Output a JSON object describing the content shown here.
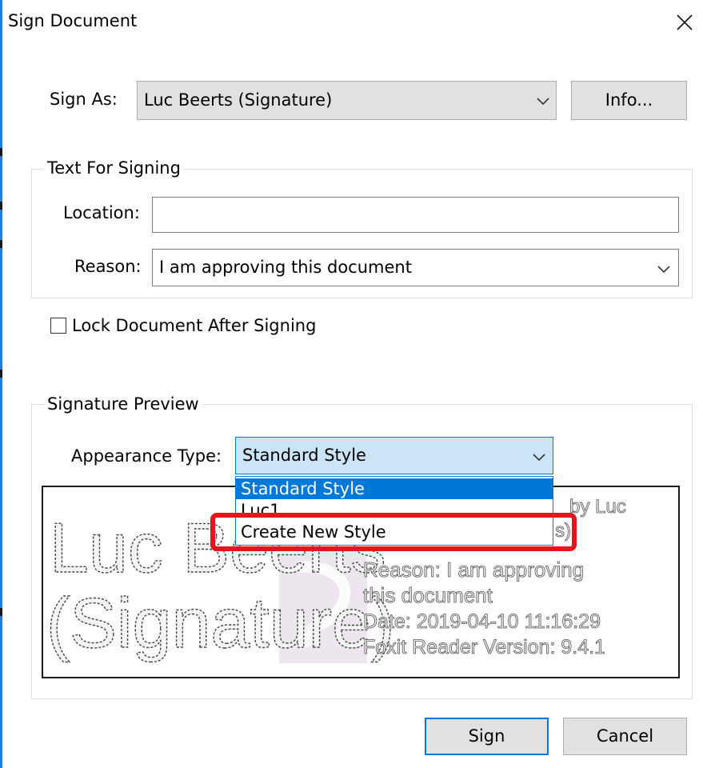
{
  "dialog": {
    "title": "Sign Document"
  },
  "sign_as": {
    "label": "Sign As:",
    "value": "Luc Beerts (Signature)",
    "info_button": "Info..."
  },
  "text_for_signing": {
    "legend": "Text For Signing",
    "location_label": "Location:",
    "location_value": "",
    "reason_label": "Reason:",
    "reason_value": "I am approving this document"
  },
  "lock_document": {
    "label": "Lock Document After Signing",
    "checked": false
  },
  "signature_preview": {
    "legend": "Signature Preview",
    "appearance_label": "Appearance Type:",
    "appearance_value": "Standard Style",
    "dropdown_options": [
      "Standard Style",
      "Luc1",
      "Create New Style"
    ],
    "preview": {
      "name_line1": "Luc Beerts",
      "name_line2": "(Signature)",
      "info_line1": "by Luc",
      "info_line2": "s)",
      "reason_line1": "Reason: I am approving",
      "reason_line2": "this document",
      "date_line": "Date: 2019-04-10 11:16:29",
      "version_line": "Foxit Reader Version: 9.4.1"
    }
  },
  "actions": {
    "sign_button": "Sign",
    "cancel_button": "Cancel"
  },
  "colors": {
    "accent": "#0078d7",
    "highlight": "#e8141c",
    "button_bg": "#e1e1e1"
  }
}
